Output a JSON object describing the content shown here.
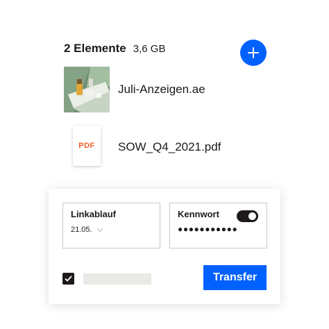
{
  "header": {
    "item_count": "2 Elemente",
    "total_size": "3,6 GB"
  },
  "add_button": {
    "icon": "plus-icon"
  },
  "files": [
    {
      "name": "Juli-Anzeigen.ae",
      "thumbnail": "image-thumbnail"
    },
    {
      "name": "SOW_Q4_2021.pdf",
      "thumbnail": "pdf-icon",
      "badge": "PDF"
    }
  ],
  "options": {
    "link_expiry": {
      "label": "Linkablauf",
      "value": "21.05."
    },
    "password": {
      "label": "Kennwort",
      "value": "●●●●●●●●●●●",
      "enabled": true
    }
  },
  "checkbox": {
    "checked": true
  },
  "transfer_button": {
    "label": "Transfer"
  },
  "colors": {
    "accent": "#0061fe",
    "text": "#1e1919",
    "pdf_badge": "#f15a22",
    "placeholder": "#ebe9e6"
  }
}
